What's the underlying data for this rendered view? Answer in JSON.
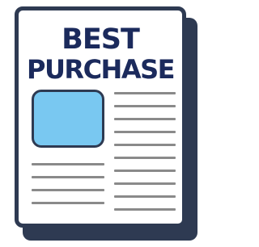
{
  "document": {
    "title_line1": "BEST",
    "title_line2": "PURCHASE"
  },
  "icon": "newspaper-document-icon",
  "colors": {
    "title": "#1b2a5c",
    "frame": "#2e3a52",
    "image_fill": "#79c8f1",
    "text_lines": "#8a8a8a"
  }
}
